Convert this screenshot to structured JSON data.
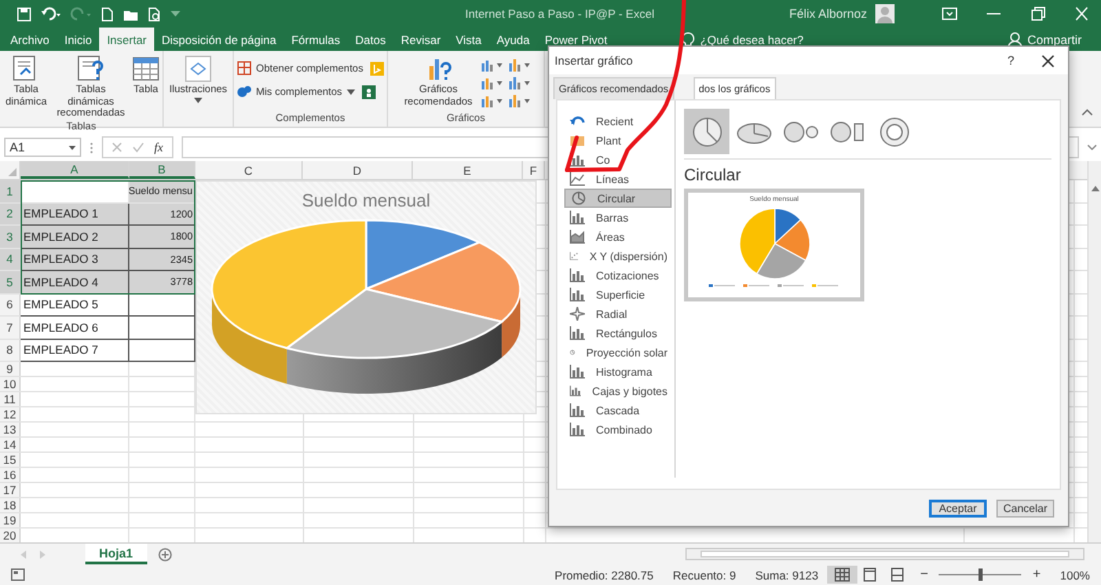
{
  "window": {
    "title": "Internet Paso a Paso - IP@P - Excel",
    "user": "Félix Albornoz"
  },
  "ribbon_tabs": [
    {
      "label": "Archivo",
      "selected": false
    },
    {
      "label": "Inicio",
      "selected": false
    },
    {
      "label": "Insertar",
      "selected": true
    },
    {
      "label": "Disposición de página",
      "selected": false
    },
    {
      "label": "Fórmulas",
      "selected": false
    },
    {
      "label": "Datos",
      "selected": false
    },
    {
      "label": "Revisar",
      "selected": false
    },
    {
      "label": "Vista",
      "selected": false
    },
    {
      "label": "Ayuda",
      "selected": false
    },
    {
      "label": "Power Pivot",
      "selected": false
    }
  ],
  "tell_me": "¿Qué desea hacer?",
  "share": "Compartir",
  "ribbon_groups": [
    {
      "label": "Tablas",
      "buttons": [
        {
          "label": "Tabla dinámica",
          "kind": "large"
        },
        {
          "label": "Tablas dinámicas recomendadas",
          "kind": "large"
        },
        {
          "label": "Tabla",
          "kind": "large"
        }
      ]
    },
    {
      "buttons": [
        {
          "label": "Ilustraciones",
          "kind": "large_menu"
        }
      ]
    },
    {
      "label": "Complementos",
      "buttons": [
        {
          "label": "Obtener complementos",
          "kind": "small"
        },
        {
          "label": "Mis complementos",
          "kind": "small_menu"
        }
      ]
    },
    {
      "label": "Gráficos",
      "buttons": [
        {
          "label": "Gráficos recomendados",
          "kind": "large"
        }
      ]
    }
  ],
  "formula_bar": {
    "name_box": "A1",
    "function_label": "fx"
  },
  "sheet": {
    "columns": [
      {
        "label": "A",
        "selected": true
      },
      {
        "label": "B",
        "selected": true
      },
      {
        "label": "C",
        "selected": false
      },
      {
        "label": "D",
        "selected": false
      },
      {
        "label": "E",
        "selected": false
      },
      {
        "label": "F",
        "selected": false
      }
    ],
    "rows": [
      {
        "number": "1",
        "b": "Sueldo mensu",
        "selected": true
      },
      {
        "number": "2",
        "a": "EMPLEADO 1",
        "b": "1200",
        "selected": true
      },
      {
        "number": "3",
        "a": "EMPLEADO 2",
        "b": "1800",
        "selected": true
      },
      {
        "number": "4",
        "a": "EMPLEADO 3",
        "b": "2345",
        "selected": true
      },
      {
        "number": "5",
        "a": "EMPLEADO 4",
        "b": "3778",
        "selected": true
      },
      {
        "number": "6",
        "a": "EMPLEADO 5",
        "selected": false
      },
      {
        "number": "7",
        "a": "EMPLEADO 6",
        "selected": false
      },
      {
        "number": "8",
        "a": "EMPLEADO 7",
        "selected": false
      },
      {
        "number": "9",
        "selected": false
      },
      {
        "number": "10",
        "selected": false
      },
      {
        "number": "11",
        "selected": false
      },
      {
        "number": "12",
        "selected": false
      },
      {
        "number": "13",
        "selected": false
      },
      {
        "number": "14",
        "selected": false
      },
      {
        "number": "15",
        "selected": false
      },
      {
        "number": "16",
        "selected": false
      },
      {
        "number": "17",
        "selected": false
      },
      {
        "number": "18",
        "selected": false
      },
      {
        "number": "19",
        "selected": false
      },
      {
        "number": "20",
        "selected": false
      }
    ],
    "chart": {
      "title": "Sueldo mensual"
    }
  },
  "dialog": {
    "title": "Insertar gráfico",
    "help": "?",
    "tabs": [
      {
        "label": "Gráficos recomendados",
        "selected": false
      },
      {
        "label": "dos los gráficos",
        "selected": true
      }
    ],
    "chart_types": [
      {
        "label": "Recient",
        "selected": false
      },
      {
        "label": "Plant",
        "selected": false
      },
      {
        "label": "Co",
        "selected": false
      },
      {
        "label": "Líneas",
        "selected": false
      },
      {
        "label": "Circular",
        "selected": true
      },
      {
        "label": "Barras",
        "selected": false
      },
      {
        "label": "Áreas",
        "selected": false
      },
      {
        "label": "X Y (dispersión)",
        "selected": false
      },
      {
        "label": "Cotizaciones",
        "selected": false
      },
      {
        "label": "Superficie",
        "selected": false
      },
      {
        "label": "Radial",
        "selected": false
      },
      {
        "label": "Rectángulos",
        "selected": false
      },
      {
        "label": "Proyección solar",
        "selected": false
      },
      {
        "label": "Histograma",
        "selected": false
      },
      {
        "label": "Cajas y bigotes",
        "selected": false
      },
      {
        "label": "Cascada",
        "selected": false
      },
      {
        "label": "Combinado",
        "selected": false
      }
    ],
    "subtypes": [
      {
        "selected": true
      },
      {
        "selected": false
      },
      {
        "selected": false
      },
      {
        "selected": false
      },
      {
        "selected": false
      }
    ],
    "heading": "Circular",
    "preview": {
      "title": "Sueldo mensual"
    },
    "buttons": [
      {
        "label": "Aceptar",
        "kind": "primary"
      },
      {
        "label": "Cancelar",
        "kind": "secondary"
      }
    ]
  },
  "sheet_tabs": [
    {
      "label": "Hoja1",
      "selected": true
    }
  ],
  "status_bar": {
    "average": "Promedio: 2280.75",
    "count": "Recuento: 9",
    "sum": "Suma: 9123",
    "zoom": "100%",
    "zoom_out": "−",
    "zoom_in": "+",
    "zoom_slider": {
      "level": 0.5
    }
  }
}
